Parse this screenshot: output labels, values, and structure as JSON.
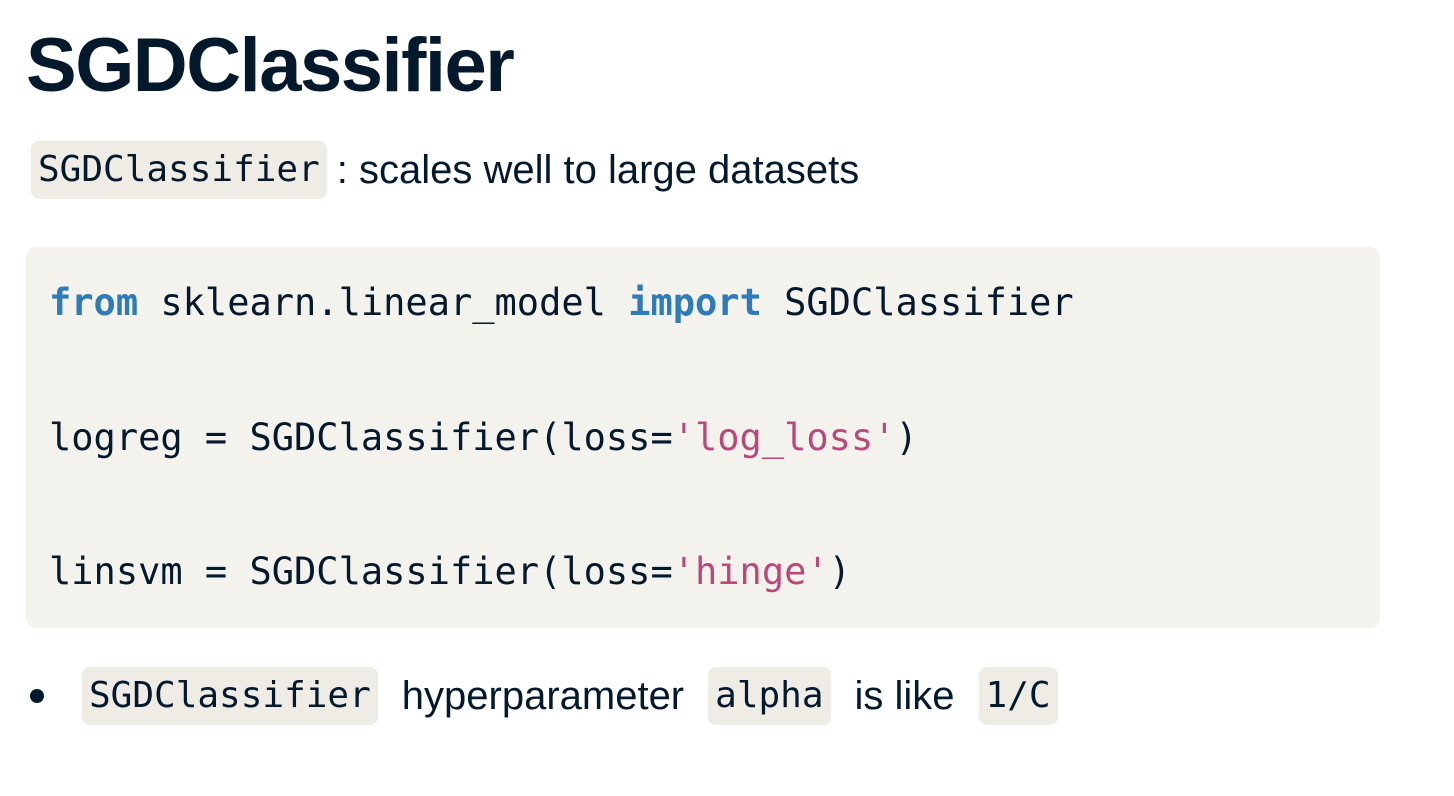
{
  "slide": {
    "title": "SGDClassifier",
    "subtitle": {
      "code": "SGDClassifier",
      "text": ": scales well to large datasets"
    },
    "code_block": {
      "line1": {
        "kw1": "from",
        "module": " sklearn.linear_model ",
        "kw2": "import",
        "name": " SGDClassifier"
      },
      "line2": {
        "prefix": "logreg = SGDClassifier(loss=",
        "string": "'log_loss'",
        "suffix": ")"
      },
      "line3": {
        "prefix": "linsvm = SGDClassifier(loss=",
        "string": "'hinge'",
        "suffix": ")"
      }
    },
    "bullet": {
      "code1": "SGDClassifier",
      "text1": "hyperparameter",
      "code2": "alpha",
      "text2": "is like",
      "code3": "1/C"
    }
  },
  "colors": {
    "text": "#05192d",
    "keyword": "#2f7ab8",
    "string": "#b8497a",
    "code_background": "#f4f2ed",
    "chip_background": "#efece6"
  }
}
